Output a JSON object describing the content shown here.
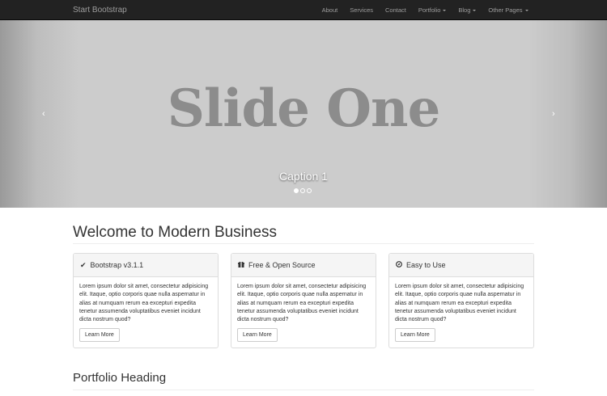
{
  "navbar": {
    "brand": "Start Bootstrap",
    "items": [
      {
        "label": "About",
        "dropdown": false
      },
      {
        "label": "Services",
        "dropdown": false
      },
      {
        "label": "Contact",
        "dropdown": false
      },
      {
        "label": "Portfolio",
        "dropdown": true
      },
      {
        "label": "Blog",
        "dropdown": true
      },
      {
        "label": "Other Pages",
        "dropdown": true
      }
    ]
  },
  "carousel": {
    "slide_text": "Slide One",
    "caption": "Caption 1",
    "prev_icon": "‹",
    "next_icon": "›",
    "slide_count": 3,
    "active_slide": 1
  },
  "main": {
    "heading": "Welcome to Modern Business",
    "panels": [
      {
        "icon": "check-icon",
        "icon_glyph": "✔",
        "title": "Bootstrap v3.1.1",
        "body": "Lorem ipsum dolor sit amet, consectetur adipisicing elit. Itaque, optio corporis quae nulla aspernatur in alias at numquam rerum ea excepturi expedita tenetur assumenda voluptatibus eveniet incidunt dicta nostrum quod?",
        "button": "Learn More"
      },
      {
        "icon": "gift-icon",
        "icon_glyph": "🎁",
        "title": "Free & Open Source",
        "body": "Lorem ipsum dolor sit amet, consectetur adipisicing elit. Itaque, optio corporis quae nulla aspernatur in alias at numquam rerum ea excepturi expedita tenetur assumenda voluptatibus eveniet incidunt dicta nostrum quod?",
        "button": "Learn More"
      },
      {
        "icon": "compass-icon",
        "icon_glyph": "⊘",
        "title": "Easy to Use",
        "body": "Lorem ipsum dolor sit amet, consectetur adipisicing elit. Itaque, optio corporis quae nulla aspernatur in alias at numquam rerum ea excepturi expedita tenetur assumenda voluptatibus eveniet incidunt dicta nostrum quod?",
        "button": "Learn More"
      }
    ],
    "portfolio_heading": "Portfolio Heading"
  }
}
